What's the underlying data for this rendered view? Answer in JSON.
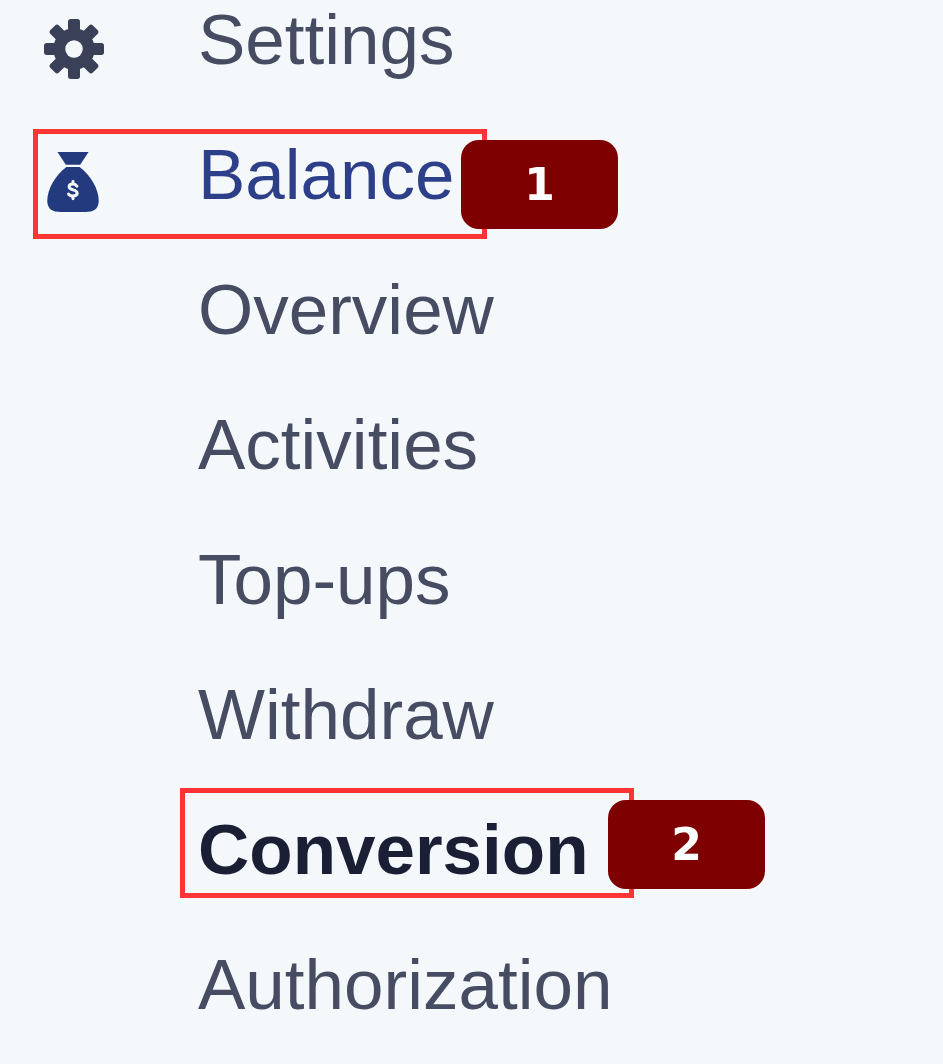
{
  "sidebar": {
    "items": [
      {
        "label": "Settings",
        "selected": false
      },
      {
        "label": "Balance",
        "selected": true,
        "callout": "1",
        "children": [
          {
            "label": "Overview",
            "selected": false
          },
          {
            "label": "Activities",
            "selected": false
          },
          {
            "label": "Top-ups",
            "selected": false
          },
          {
            "label": "Withdraw",
            "selected": false
          },
          {
            "label": "Conversion",
            "selected": true,
            "callout": "2"
          },
          {
            "label": "Authorization",
            "selected": false
          }
        ]
      }
    ]
  }
}
